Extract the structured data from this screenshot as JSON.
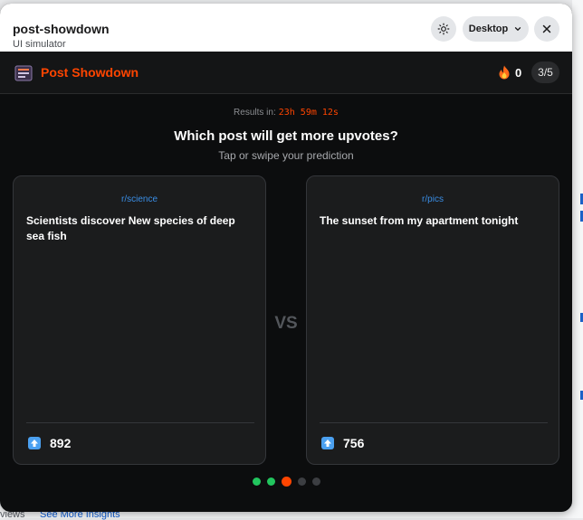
{
  "simulator": {
    "title": "post-showdown",
    "subtitle": "UI simulator",
    "device_label": "Desktop",
    "theme_icon": "sun-icon",
    "close_icon": "close-icon"
  },
  "app": {
    "title": "Post Showdown",
    "brand_color": "#ff4500",
    "streak_count": "0",
    "round": "3/5"
  },
  "prompt": {
    "results_label": "Results in:",
    "timer": "23h 59m 12s",
    "question": "Which post will get more upvotes?",
    "instruction": "Tap or swipe your prediction"
  },
  "posts": [
    {
      "subreddit": "r/science",
      "title": "Scientists discover New species of deep sea fish",
      "upvotes": "892"
    },
    {
      "subreddit": "r/pics",
      "title": "The sunset from my apartment tonight",
      "upvotes": "756"
    }
  ],
  "vs_label": "VS",
  "progress": {
    "current_round": 3,
    "total_rounds": 5,
    "dot_colors": [
      "#22c55e",
      "#22c55e",
      "#ff4500",
      "#3c3e42",
      "#3c3e42"
    ]
  },
  "background": {
    "views_label": "views",
    "insights_link": "See More Insights"
  }
}
